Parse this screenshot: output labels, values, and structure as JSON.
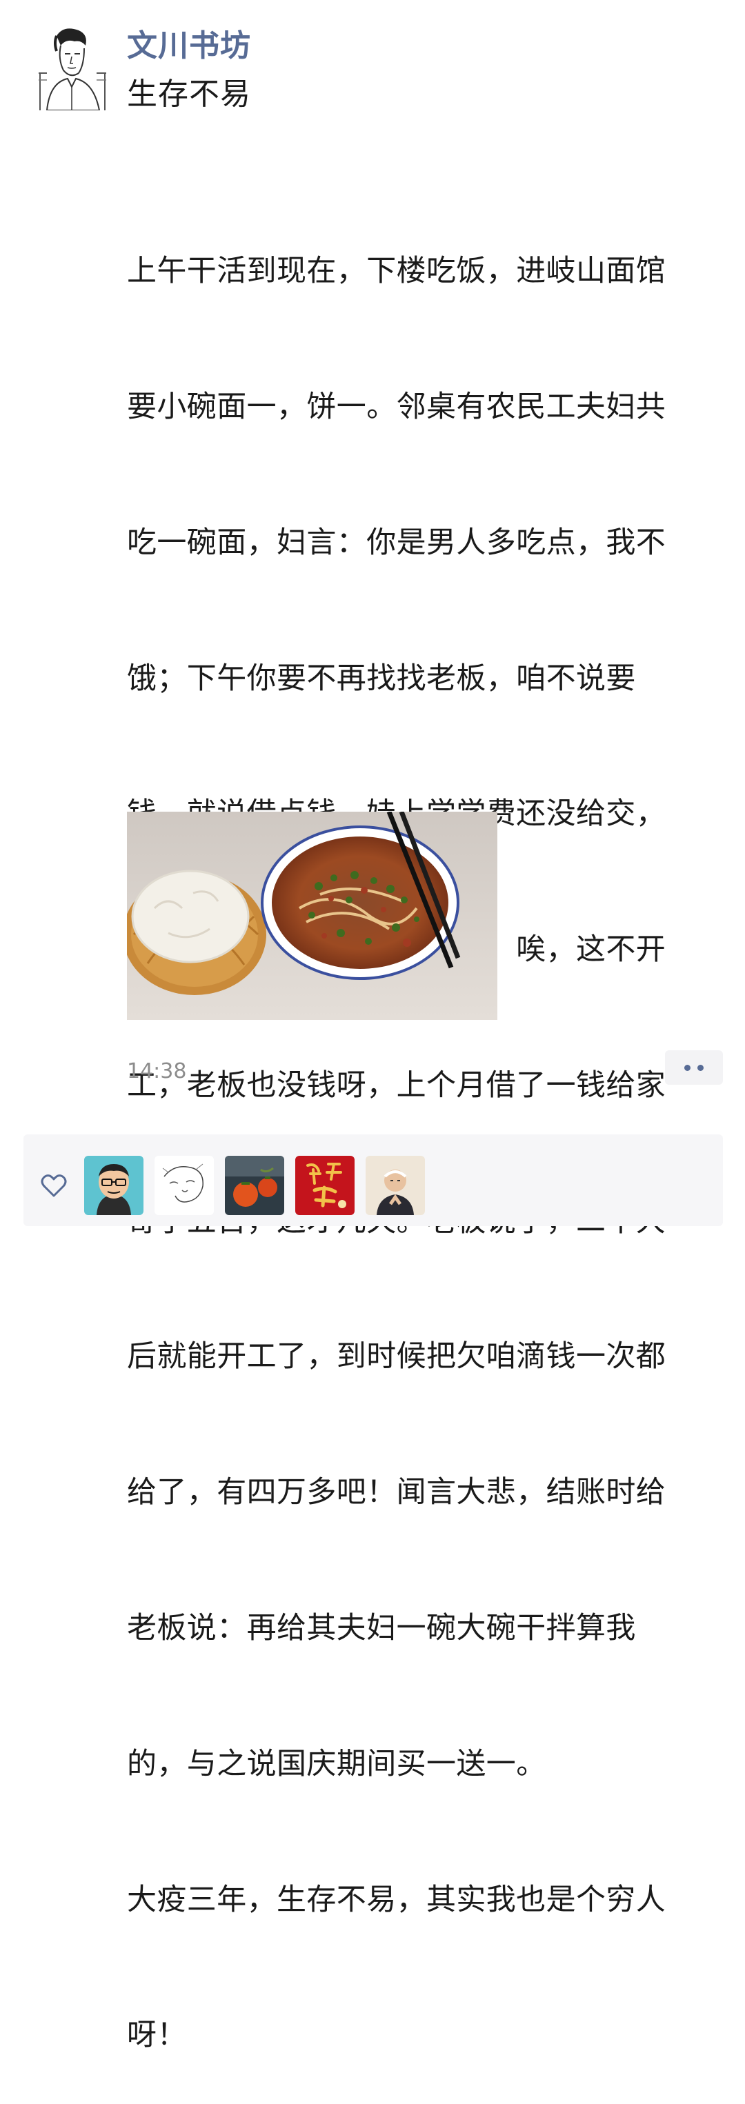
{
  "post": {
    "author": "文川书坊",
    "title": "生存不易",
    "body_lines": [
      "上午干活到现在，下楼吃饭，进岐山面馆",
      "要小碗面一，饼一。邻桌有农民工夫妇共",
      "吃一碗面，妇言：你是男人多吃点，我不",
      "饿；下午你要不再找找老板，咱不说要",
      "钱，就说借点钱，娃上学学费还没给交，",
      "咱这吃饭的钱都没了。夫言：唉，这不开",
      "工，老板也没钱呀，上个月借了一钱给家",
      "寄了五百，这才几天。老板说了，二十大",
      "后就能开工了，到时候把欠咱滴钱一次都",
      "给了，有四万多吧！闻言大悲，结账时给",
      "老板说：再给其夫妇一碗大碗干拌算我",
      "的，与之说国庆期间买一送一。",
      "大疫三年，生存不易，其实我也是个穷人",
      "呀！"
    ],
    "timestamp": "14:38"
  },
  "icons": {
    "avatar": "author-avatar-sketch",
    "photo": "noodle-bowl-and-flatbread-photo",
    "more": "more-dots-icon",
    "like": "heart-outline-icon"
  },
  "likes": {
    "avatars": [
      "liker-avatar-1",
      "liker-avatar-2",
      "liker-avatar-3",
      "liker-avatar-4",
      "liker-avatar-5"
    ]
  },
  "colors": {
    "author_name": "#576b95",
    "timestamp": "#8c8c8c",
    "panel_bg": "#f6f6f8"
  }
}
